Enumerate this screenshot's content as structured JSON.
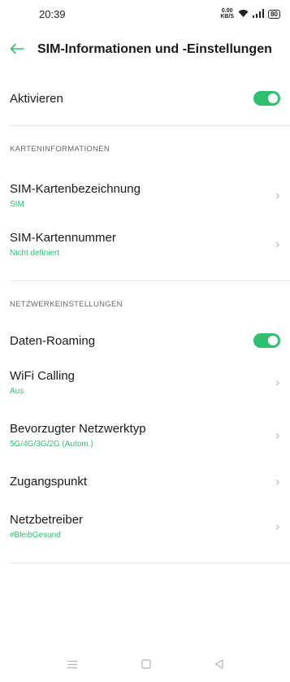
{
  "status_bar": {
    "time": "20:39",
    "net_speed_value": "0.00",
    "net_speed_unit": "KB/S",
    "battery": "80"
  },
  "header": {
    "title": "SIM-Informationen und -Einstellungen"
  },
  "activate": {
    "label": "Aktivieren",
    "enabled": true
  },
  "card_section": {
    "heading": "KARTENINFORMATIONEN",
    "items": [
      {
        "label": "SIM-Kartenbezeichnung",
        "value": "SIM"
      },
      {
        "label": "SIM-Kartennummer",
        "value": "Nicht definiert"
      }
    ]
  },
  "network_section": {
    "heading": "NETZWERKEINSTELLUNGEN",
    "roaming": {
      "label": "Daten-Roaming",
      "enabled": true
    },
    "items": [
      {
        "label": "WiFi Calling",
        "value": "Aus"
      },
      {
        "label": "Bevorzugter Netzwerktyp",
        "value": "5G/4G/3G/2G (Autom.)"
      },
      {
        "label": "Zugangspunkt"
      },
      {
        "label": "Netzbetreiber",
        "value": "#BleibGesund"
      }
    ]
  },
  "colors": {
    "accent": "#2fbf71"
  }
}
